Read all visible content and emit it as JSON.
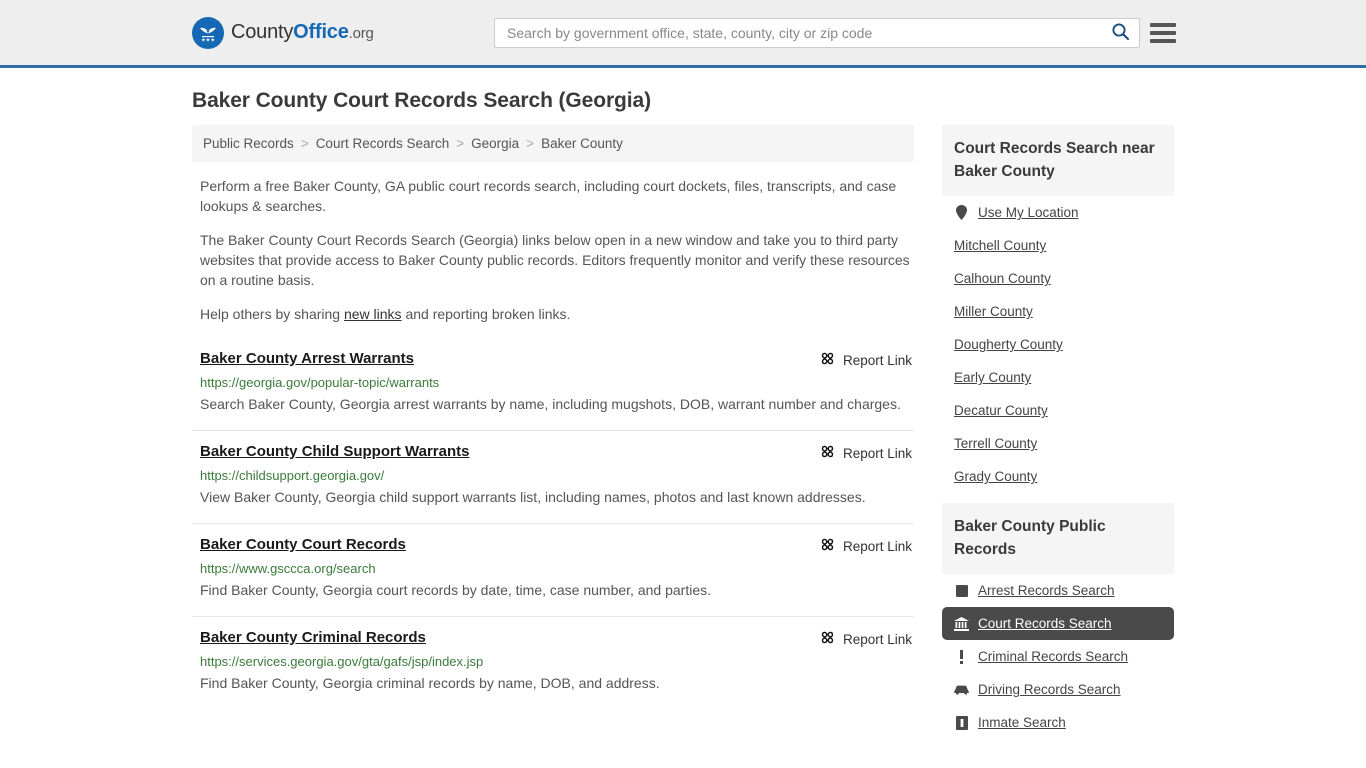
{
  "header": {
    "logo": {
      "icon": "eagle-stars-seal-icon",
      "text_county": "County",
      "text_office": "Office",
      "text_org": ".org"
    },
    "search": {
      "placeholder": "Search by government office, state, county, city or zip code",
      "value": "",
      "icon": "search-icon"
    },
    "menu_icon": "hamburger-menu-icon"
  },
  "page": {
    "title": "Baker County Court Records Search (Georgia)"
  },
  "breadcrumb": {
    "separator": ">",
    "items": [
      {
        "label": "Public Records"
      },
      {
        "label": "Court Records Search"
      },
      {
        "label": "Georgia"
      },
      {
        "label": "Baker County"
      }
    ]
  },
  "intro": {
    "p1": "Perform a free Baker County, GA public court records search, including court dockets, files, transcripts, and case lookups & searches.",
    "p2": "The Baker County Court Records Search (Georgia) links below open in a new window and take you to third party websites that provide access to Baker County public records. Editors frequently monitor and verify these resources on a routine basis.",
    "p3_before": "Help others by sharing ",
    "p3_link": "new links",
    "p3_after": " and reporting broken links."
  },
  "results": {
    "report_label": "Report Link",
    "report_icon": "broken-link-icon",
    "items": [
      {
        "title": "Baker County Arrest Warrants",
        "url": "https://georgia.gov/popular-topic/warrants",
        "description": "Search Baker County, Georgia arrest warrants by name, including mugshots, DOB, warrant number and charges."
      },
      {
        "title": "Baker County Child Support Warrants",
        "url": "https://childsupport.georgia.gov/",
        "description": "View Baker County, Georgia child support warrants list, including names, photos and last known addresses."
      },
      {
        "title": "Baker County Court Records",
        "url": "https://www.gsccca.org/search",
        "description": "Find Baker County, Georgia court records by date, time, case number, and parties."
      },
      {
        "title": "Baker County Criminal Records",
        "url": "https://services.georgia.gov/gta/gafs/jsp/index.jsp",
        "description": "Find Baker County, Georgia criminal records by name, DOB, and address."
      }
    ]
  },
  "sidebar": {
    "nearby": {
      "title": "Court Records Search near Baker County",
      "use_location": {
        "label": "Use My Location",
        "icon": "map-pin-icon"
      },
      "counties": [
        {
          "label": "Mitchell County"
        },
        {
          "label": "Calhoun County"
        },
        {
          "label": "Miller County"
        },
        {
          "label": "Dougherty County"
        },
        {
          "label": "Early County"
        },
        {
          "label": "Decatur County"
        },
        {
          "label": "Terrell County"
        },
        {
          "label": "Grady County"
        }
      ]
    },
    "public_records": {
      "title": "Baker County Public Records",
      "items": [
        {
          "label": "Arrest Records Search",
          "icon": "square-icon",
          "active": false
        },
        {
          "label": "Court Records Search",
          "icon": "courthouse-icon",
          "active": true
        },
        {
          "label": "Criminal Records Search",
          "icon": "exclamation-icon",
          "active": false
        },
        {
          "label": "Driving Records Search",
          "icon": "car-icon",
          "active": false
        },
        {
          "label": "Inmate Search",
          "icon": "inmate-icon",
          "active": false
        }
      ]
    }
  },
  "colors": {
    "brand_blue": "#1569b4",
    "header_bg": "#eeeeee",
    "header_border": "#2e6da4",
    "url_green": "#3a7a3a",
    "active_bg": "#4a4a4a",
    "panel_bg": "#f5f5f5"
  }
}
